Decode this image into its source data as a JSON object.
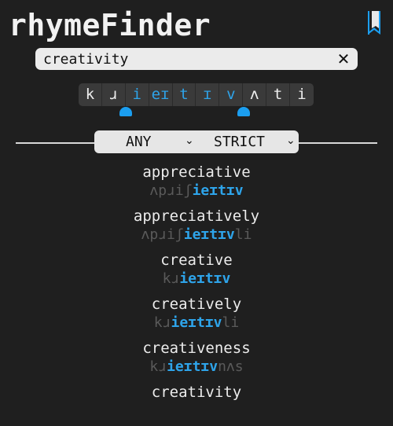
{
  "app": {
    "title": "rhymeFinder"
  },
  "search": {
    "value": "creativity",
    "clear_icon": "close-icon"
  },
  "phonemes": [
    {
      "symbol": "k",
      "selected": false
    },
    {
      "symbol": "ɹ",
      "selected": false
    },
    {
      "symbol": "i",
      "selected": true
    },
    {
      "symbol": "eɪ",
      "selected": true
    },
    {
      "symbol": "t",
      "selected": true
    },
    {
      "symbol": "ɪ",
      "selected": true
    },
    {
      "symbol": "v",
      "selected": true
    },
    {
      "symbol": "ʌ",
      "selected": false
    },
    {
      "symbol": "t",
      "selected": false
    },
    {
      "symbol": "i",
      "selected": false
    }
  ],
  "modes": {
    "match": "ANY",
    "strictness": "STRICT",
    "chevron": "⌄"
  },
  "results": [
    {
      "word": "appreciative",
      "ipa_pre": "ʌpɹiʃ",
      "ipa_match": "ieɪtɪv",
      "ipa_post": ""
    },
    {
      "word": "appreciatively",
      "ipa_pre": "ʌpɹiʃ",
      "ipa_match": "ieɪtɪv",
      "ipa_post": "li"
    },
    {
      "word": "creative",
      "ipa_pre": "kɹ",
      "ipa_match": "ieɪtɪv",
      "ipa_post": ""
    },
    {
      "word": "creatively",
      "ipa_pre": "kɹ",
      "ipa_match": "ieɪtɪv",
      "ipa_post": "li"
    },
    {
      "word": "creativeness",
      "ipa_pre": "kɹ",
      "ipa_match": "ieɪtɪv",
      "ipa_post": "nʌs"
    },
    {
      "word": "creativity",
      "ipa_pre": "",
      "ipa_match": "",
      "ipa_post": ""
    }
  ],
  "colors": {
    "accent": "#2ea4ea",
    "background": "#1f1f1f",
    "dim": "#5a5a5a"
  }
}
